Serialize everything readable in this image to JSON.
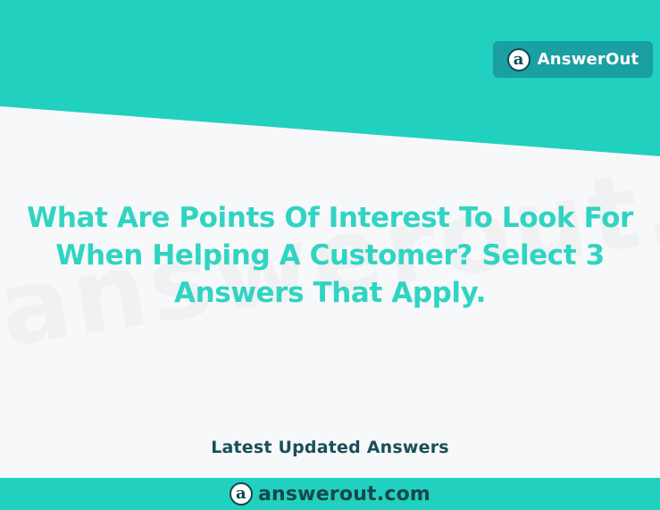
{
  "brand": {
    "logo_glyph": "a",
    "name": "AnswerOut",
    "badge_color": "#1a9fa3"
  },
  "question": {
    "text": "What Are Points Of Interest To Look For When Helping A Customer? Select 3 Answers That Apply."
  },
  "watermark": {
    "text": "answerout.com"
  },
  "section": {
    "label": "Latest Updated Answers"
  },
  "footer": {
    "logo_glyph": "a",
    "url": "answerout.com"
  },
  "colors": {
    "accent": "#22d0bf",
    "heading": "#30d4c2",
    "dark_text": "#1a4f59",
    "background": "#f7f8fa"
  },
  "icons": {
    "brand_logo": "answerout-logo-icon",
    "footer_logo": "answerout-logo-icon"
  }
}
